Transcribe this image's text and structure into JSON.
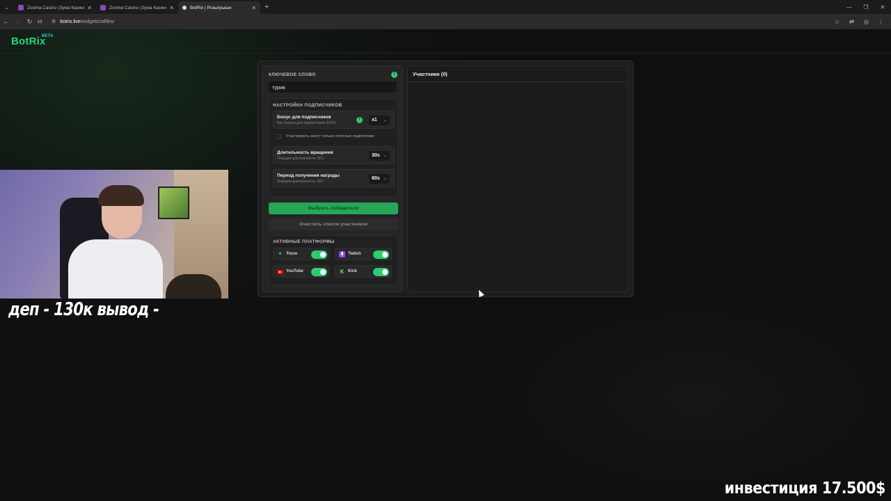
{
  "browser": {
    "tabs": [
      {
        "label": "Zooma Casino (Зума Казино)",
        "active": false
      },
      {
        "label": "Zooma Casino (Зума Казино) с",
        "active": false
      },
      {
        "label": "BotRix | Розыгрыши",
        "active": true
      }
    ],
    "nav_count": "13",
    "url_host": "botrix.live",
    "url_path": "/widgets/raffles/"
  },
  "site": {
    "logo": "BotRix",
    "logo_badge": "BETA"
  },
  "raffle": {
    "keyword_label": "КЛЮЧЕВОЕ СЛОВО",
    "keyword_value": "турик",
    "subscriber_settings_label": "НАСТРОЙКИ ПОДПИСЧИКОВ",
    "bonus_title": "Бонус для подписчиков",
    "bonus_desc": "Без бонуса для подписчиков (OFF)",
    "bonus_value": "x1",
    "paid_only_label": "Участвовать могут только платные подписчики",
    "spin_title": "Длительность вращения",
    "spin_desc": "Текущая длительность: 30 с",
    "spin_value": "30s",
    "claim_title": "Период получения награды",
    "claim_desc": "Текущая длительность: 60 с",
    "claim_value": "60s",
    "pick_winner_label": "Выбрать победителя",
    "clear_label": "Очистить список участников",
    "platforms_label": "АКТИВНЫЕ ПЛАТФОРМЫ",
    "platforms": [
      {
        "name": "Trovo",
        "enabled": true,
        "color": "#1bd96a"
      },
      {
        "name": "Twitch",
        "enabled": true,
        "color": "#9146ff"
      },
      {
        "name": "YouTube",
        "enabled": true,
        "color": "#ff0000"
      },
      {
        "name": "Kick",
        "enabled": true,
        "color": "#53fc18"
      }
    ],
    "participants_title": "Участники (0)"
  },
  "stream_overlay": {
    "dep_text": "деп - 130к вывод -",
    "invest_text": "инвестиция 17.500$"
  },
  "colors": {
    "accent": "#2ecc71",
    "logo": "#2ad27d"
  }
}
